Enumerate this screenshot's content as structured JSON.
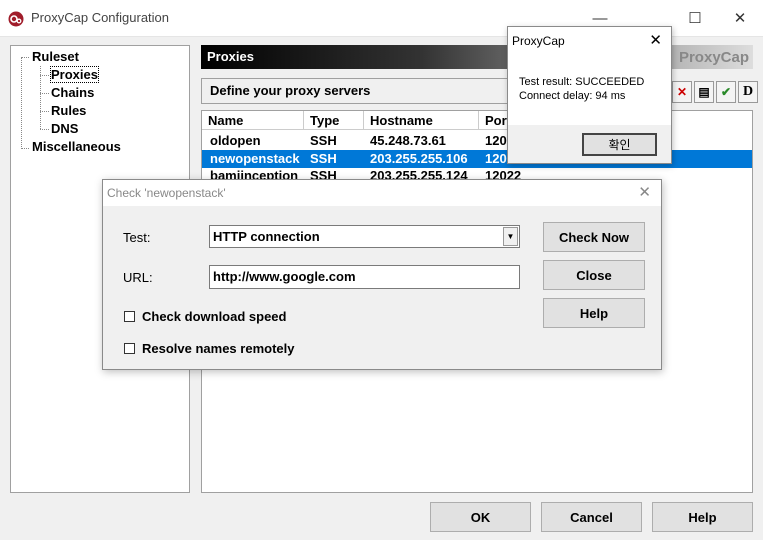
{
  "window": {
    "title": "ProxyCap Configuration",
    "minimize": "—",
    "maximize": "☐",
    "close": "✕"
  },
  "tree": {
    "root": "Ruleset",
    "children": [
      "Proxies",
      "Chains",
      "Rules",
      "DNS"
    ],
    "misc": "Miscellaneous"
  },
  "proxies_panel": {
    "header": "Proxies",
    "logo": "ProxyCap",
    "define_label": "Define your proxy servers",
    "toolbar_last": "D",
    "columns": [
      "Name",
      "Type",
      "Hostname",
      "Port"
    ],
    "rows": [
      [
        "oldopen",
        "SSH",
        "45.248.73.61",
        "120"
      ],
      [
        "newopenstack",
        "SSH",
        "203.255.255.106",
        "120"
      ],
      [
        "bamiinception",
        "SSH",
        "203.255.255.124",
        "12022"
      ]
    ]
  },
  "footer": {
    "ok": "OK",
    "cancel": "Cancel",
    "help": "Help"
  },
  "result_popup": {
    "title": "ProxyCap",
    "line1": "Test result: SUCCEEDED",
    "line2": "Connect delay: 94 ms",
    "button": "확인"
  },
  "check_dialog": {
    "title": "Check 'newopenstack'",
    "test_label": "Test:",
    "test_value": "HTTP connection",
    "url_label": "URL:",
    "url_value": "http://www.google.com",
    "check_download": "Check download speed",
    "resolve_remote": "Resolve names remotely",
    "check_now": "Check Now",
    "close": "Close",
    "help": "Help"
  },
  "colors": {
    "selection": "#0078d7",
    "delete_icon": "#cc0000",
    "check_icon": "#2a8a2a"
  }
}
